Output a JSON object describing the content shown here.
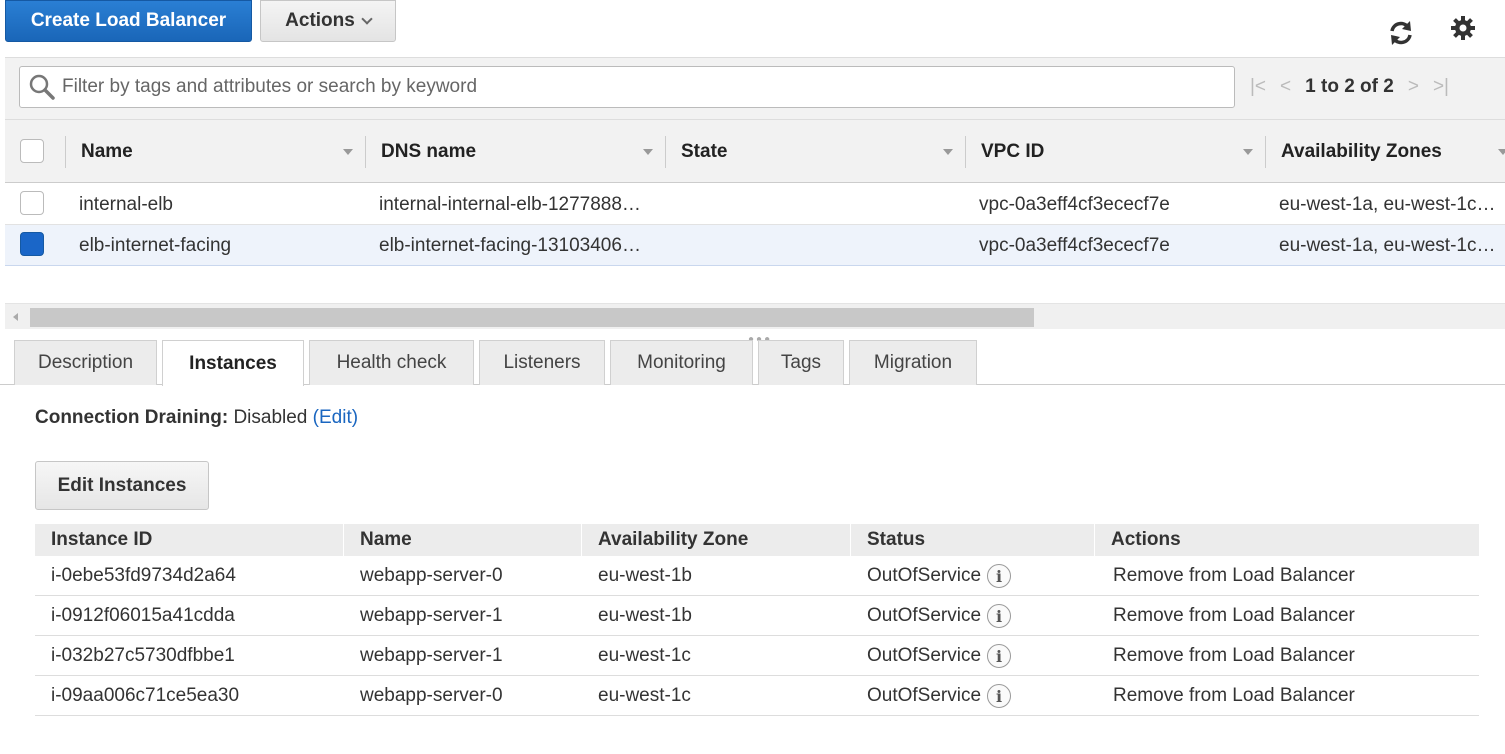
{
  "toolbar": {
    "create_label": "Create Load Balancer",
    "actions_label": "Actions"
  },
  "filter": {
    "placeholder": "Filter by tags and attributes or search by keyword",
    "pager_text": "1 to 2 of 2"
  },
  "grid": {
    "columns": [
      "Name",
      "DNS name",
      "State",
      "VPC ID",
      "Availability Zones"
    ],
    "rows": [
      {
        "name": "internal-elb",
        "dns": "internal-internal-elb-1277888…",
        "state": "",
        "vpc": "vpc-0a3eff4cf3ececf7e",
        "azs": "eu-west-1a, eu-west-1c…",
        "selected": false
      },
      {
        "name": "elb-internet-facing",
        "dns": "elb-internet-facing-13103406…",
        "state": "",
        "vpc": "vpc-0a3eff4cf3ececf7e",
        "azs": "eu-west-1a, eu-west-1c…",
        "selected": true
      }
    ]
  },
  "tabs": [
    "Description",
    "Instances",
    "Health check",
    "Listeners",
    "Monitoring",
    "Tags",
    "Migration"
  ],
  "active_tab": "Instances",
  "instances": {
    "draining_label": "Connection Draining:",
    "draining_value": "Disabled",
    "draining_edit": "(Edit)",
    "edit_button": "Edit Instances",
    "columns": [
      "Instance ID",
      "Name",
      "Availability Zone",
      "Status",
      "Actions"
    ],
    "rows": [
      {
        "id": "i-0ebe53fd9734d2a64",
        "name": "webapp-server-0",
        "az": "eu-west-1b",
        "status": "OutOfService",
        "action": "Remove from Load Balancer"
      },
      {
        "id": "i-0912f06015a41cdda",
        "name": "webapp-server-1",
        "az": "eu-west-1b",
        "status": "OutOfService",
        "action": "Remove from Load Balancer"
      },
      {
        "id": "i-032b27c5730dfbbe1",
        "name": "webapp-server-1",
        "az": "eu-west-1c",
        "status": "OutOfService",
        "action": "Remove from Load Balancer"
      },
      {
        "id": "i-09aa006c71ce5ea30",
        "name": "webapp-server-0",
        "az": "eu-west-1c",
        "status": "OutOfService",
        "action": "Remove from Load Balancer"
      }
    ]
  },
  "colors": {
    "primary": "#1a66b8",
    "link": "#1a66c0",
    "selected_row": "#eef3fb"
  }
}
